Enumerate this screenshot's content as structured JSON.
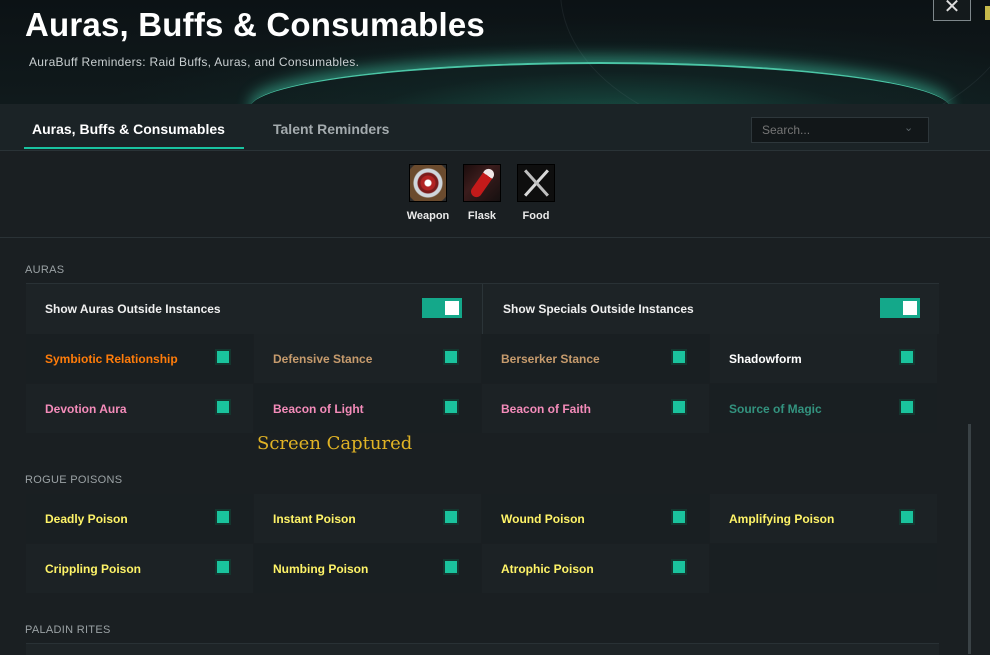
{
  "window": {
    "title": "Auras, Buffs & Consumables",
    "subtitle": "AuraBuff Reminders: Raid Buffs, Auras, and Consumables.",
    "close_glyph": "✕"
  },
  "tabs": [
    {
      "label": "Auras, Buffs & Consumables",
      "active": true
    },
    {
      "label": "Talent Reminders",
      "active": false
    }
  ],
  "search": {
    "placeholder": "Search...",
    "chevron": "⌄"
  },
  "consumables": [
    {
      "label": "Weapon",
      "icon": "weapon-enchant-icon"
    },
    {
      "label": "Flask",
      "icon": "flask-icon"
    },
    {
      "label": "Food",
      "icon": "food-icon"
    }
  ],
  "sections": {
    "auras": {
      "label": "AURAS",
      "toggles": [
        {
          "label": "Show Auras Outside Instances",
          "on": true
        },
        {
          "label": "Show Specials Outside Instances",
          "on": true
        }
      ],
      "rows": [
        [
          {
            "label": "Symbiotic Relationship",
            "color": "#ff7c0a",
            "checked": true
          },
          {
            "label": "Defensive Stance",
            "color": "#c69b6d",
            "checked": true
          },
          {
            "label": "Berserker Stance",
            "color": "#c69b6d",
            "checked": true
          },
          {
            "label": "Shadowform",
            "color": "#ffffff",
            "checked": true
          }
        ],
        [
          {
            "label": "Devotion Aura",
            "color": "#f48cba",
            "checked": true
          },
          {
            "label": "Beacon of Light",
            "color": "#f48cba",
            "checked": true
          },
          {
            "label": "Beacon of Faith",
            "color": "#f48cba",
            "checked": true
          },
          {
            "label": "Source of Magic",
            "color": "#33937f",
            "checked": true
          }
        ]
      ]
    },
    "rogue_poisons": {
      "label": "ROGUE POISONS",
      "rows": [
        [
          {
            "label": "Deadly Poison",
            "color": "#fff468",
            "checked": true
          },
          {
            "label": "Instant Poison",
            "color": "#fff468",
            "checked": true
          },
          {
            "label": "Wound Poison",
            "color": "#fff468",
            "checked": true
          },
          {
            "label": "Amplifying Poison",
            "color": "#fff468",
            "checked": true
          }
        ],
        [
          {
            "label": "Crippling Poison",
            "color": "#fff468",
            "checked": true
          },
          {
            "label": "Numbing Poison",
            "color": "#fff468",
            "checked": true
          },
          {
            "label": "Atrophic Poison",
            "color": "#fff468",
            "checked": true
          }
        ]
      ]
    },
    "paladin_rites": {
      "label": "PALADIN RITES"
    }
  },
  "overlay": {
    "text": "Screen Captured"
  },
  "colors": {
    "accent": "#19c3a0",
    "checkbox": "#1ac39d",
    "toggle": "#14a88a",
    "overlay": "#e0b325"
  }
}
